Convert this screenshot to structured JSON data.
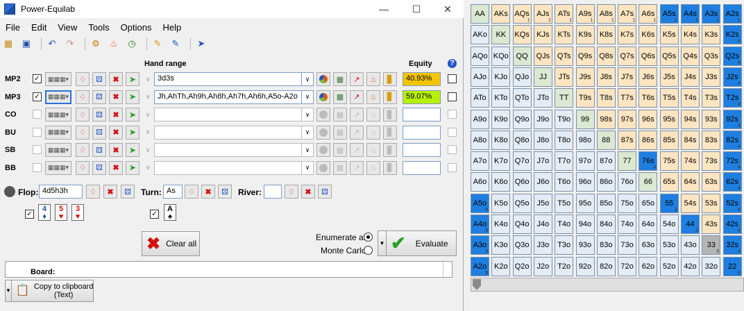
{
  "app": {
    "title": "Power-Equilab"
  },
  "window_controls": {
    "minimize": "—",
    "maximize": "☐",
    "close": "✕"
  },
  "menu": [
    "File",
    "Edit",
    "View",
    "Tools",
    "Options",
    "Help"
  ],
  "columns": {
    "hand_range": "Hand range",
    "equity": "Equity",
    "help": "?"
  },
  "players": [
    {
      "name": "MP2",
      "checked": true,
      "range": "3d3s",
      "equity": "40.93%",
      "equity_color": "#f5c400",
      "active": true
    },
    {
      "name": "MP3",
      "checked": true,
      "range": "Jh,AhTh,Ah9h,Ah8h,Ah7h,Ah6h,A5o-A2o",
      "equity": "59.07%",
      "equity_color": "#b7f000",
      "active": true
    },
    {
      "name": "CO",
      "checked": false,
      "range": "",
      "equity": "",
      "active": false
    },
    {
      "name": "BU",
      "checked": false,
      "range": "",
      "equity": "",
      "active": false
    },
    {
      "name": "SB",
      "checked": false,
      "range": "",
      "equity": "",
      "active": false
    },
    {
      "name": "BB",
      "checked": false,
      "range": "",
      "equity": "",
      "active": false
    }
  ],
  "board": {
    "flop_label": "Flop:",
    "flop_value": "4d5h3h",
    "turn_label": "Turn:",
    "turn_value": "As",
    "river_label": "River:",
    "river_value": "",
    "flop_cards": [
      {
        "rank": "4",
        "suit": "♦",
        "color": "#1f4fc0"
      },
      {
        "rank": "5",
        "suit": "♥",
        "color": "#d41010"
      },
      {
        "rank": "3",
        "suit": "♥",
        "color": "#d41010"
      }
    ],
    "turn_cards": [
      {
        "rank": "A",
        "suit": "♠",
        "color": "#000000"
      }
    ]
  },
  "actions": {
    "clear_all": "Clear all",
    "enumerate_all": "Enumerate all",
    "monte_carlo": "Monte Carlo",
    "evaluate": "Evaluate",
    "copy_clipboard": "Copy to clipboard\n(Text)",
    "results_header": "Board:"
  },
  "matrix_colors": {
    "pair": "#dbe8d2",
    "suited": "#fde5c1",
    "offsuit": "#e4ecf5",
    "selected": "#1e7fe0",
    "dead": "#b5b5b5"
  },
  "matrix": [
    [
      "AA",
      "AKs",
      "AQs",
      "AJs",
      "ATs",
      "A9s",
      "A8s",
      "A7s",
      "A6s",
      "A5s",
      "A4s",
      "A3s",
      "A2s"
    ],
    [
      "AKo",
      "KK",
      "KQs",
      "KJs",
      "KTs",
      "K9s",
      "K8s",
      "K7s",
      "K6s",
      "K5s",
      "K4s",
      "K3s",
      "K2s"
    ],
    [
      "AQo",
      "KQo",
      "QQ",
      "QJs",
      "QTs",
      "Q9s",
      "Q8s",
      "Q7s",
      "Q6s",
      "Q5s",
      "Q4s",
      "Q3s",
      "Q2s"
    ],
    [
      "AJo",
      "KJo",
      "QJo",
      "JJ",
      "JTs",
      "J9s",
      "J8s",
      "J7s",
      "J6s",
      "J5s",
      "J4s",
      "J3s",
      "J2s"
    ],
    [
      "ATo",
      "KTo",
      "QTo",
      "JTo",
      "TT",
      "T9s",
      "T8s",
      "T7s",
      "T6s",
      "T5s",
      "T4s",
      "T3s",
      "T2s"
    ],
    [
      "A9o",
      "K9o",
      "Q9o",
      "J9o",
      "T9o",
      "99",
      "98s",
      "97s",
      "96s",
      "95s",
      "94s",
      "93s",
      "92s"
    ],
    [
      "A8o",
      "K8o",
      "Q8o",
      "J8o",
      "T8o",
      "98o",
      "88",
      "87s",
      "86s",
      "85s",
      "84s",
      "83s",
      "82s"
    ],
    [
      "A7o",
      "K7o",
      "Q7o",
      "J7o",
      "T7o",
      "97o",
      "87o",
      "77",
      "76s",
      "75s",
      "74s",
      "73s",
      "72s"
    ],
    [
      "A6o",
      "K6o",
      "Q6o",
      "J6o",
      "T6o",
      "96o",
      "86o",
      "76o",
      "66",
      "65s",
      "64s",
      "63s",
      "62s"
    ],
    [
      "A5o",
      "K5o",
      "Q5o",
      "J5o",
      "T5o",
      "95o",
      "85o",
      "75o",
      "65o",
      "55",
      "54s",
      "53s",
      "52s"
    ],
    [
      "A4o",
      "K4o",
      "Q4o",
      "J4o",
      "T4o",
      "94o",
      "84o",
      "74o",
      "64o",
      "54o",
      "44",
      "43s",
      "42s"
    ],
    [
      "A3o",
      "K3o",
      "Q3o",
      "J3o",
      "T3o",
      "93o",
      "83o",
      "73o",
      "63o",
      "53o",
      "43o",
      "33",
      "32s"
    ],
    [
      "A2o",
      "K2o",
      "Q2o",
      "J2o",
      "T2o",
      "92o",
      "82o",
      "72o",
      "62o",
      "52o",
      "42o",
      "32o",
      "22"
    ]
  ],
  "selected_cells": [
    "A5s",
    "A4s",
    "A3s",
    "A2s",
    "K2s",
    "Q2s",
    "J2s",
    "T2s",
    "92s",
    "82s",
    "72s",
    "62s",
    "52s",
    "42s",
    "32s",
    "76s",
    "55",
    "44",
    "22",
    "A5o",
    "A4o",
    "A3o",
    "A2o"
  ],
  "dead_cells": [
    "33"
  ],
  "cell_counts": {
    "A5s": "1",
    "A4s": "1",
    "A3s": "1",
    "A2s": "1",
    "AQs": "1",
    "AJs": "1",
    "ATs": "1",
    "A9s": "1",
    "A8s": "1",
    "A7s": "1",
    "A6s": "1",
    "K2s": "4",
    "Q2s": "4",
    "J2s": "4",
    "T2s": "4",
    "92s": "4",
    "82s": "4",
    "72s": "4",
    "62s": "4",
    "52s": "4",
    "42s": "4",
    "32s": "4",
    "76s": "4",
    "55": "3",
    "44": "3",
    "22": "6",
    "33": "0",
    "A5o": "9",
    "A4o": "9",
    "A3o": "9",
    "A2o": "9"
  }
}
